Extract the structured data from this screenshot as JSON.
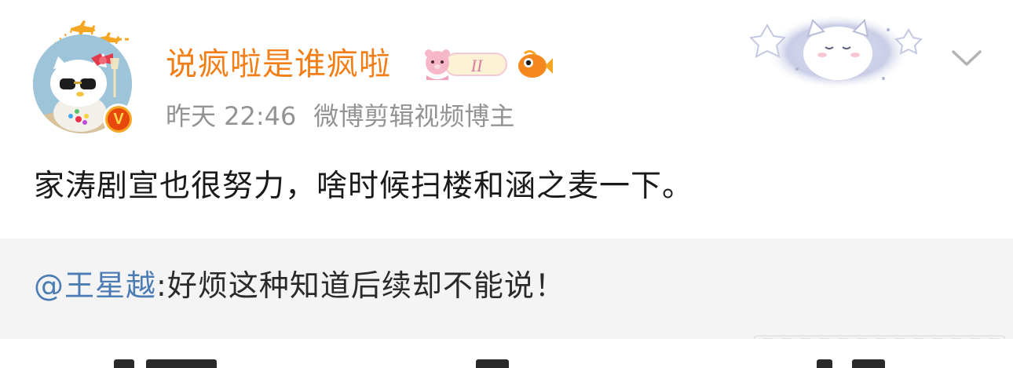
{
  "post": {
    "username": "说疯啦是谁疯啦",
    "time": "昨天 22:46",
    "tag": "微博剪辑视频博主",
    "verified_mark": "V",
    "badge_text": "II",
    "content": "家涛剧宣也很努力，啥时候扫楼和涵之麦一下。",
    "repost": {
      "mention": "@王星越",
      "text": ":好烦这种知道后续却不能说！"
    }
  },
  "icons": {
    "avatar": "hello-kitty-avatar",
    "verified": "verified-v-icon",
    "member_badge": "pink-bear-badge-icon",
    "fan_badge": "fish-badge-icon",
    "decoration": "sleeping-cat-cloud-icon",
    "menu": "chevron-down-icon"
  },
  "colors": {
    "username": "#f17e16",
    "meta": "#939393",
    "content": "#1a1a1a",
    "mention": "#4b7db4",
    "repost_bg": "#f4f4f4",
    "verified": "#e8480c"
  }
}
